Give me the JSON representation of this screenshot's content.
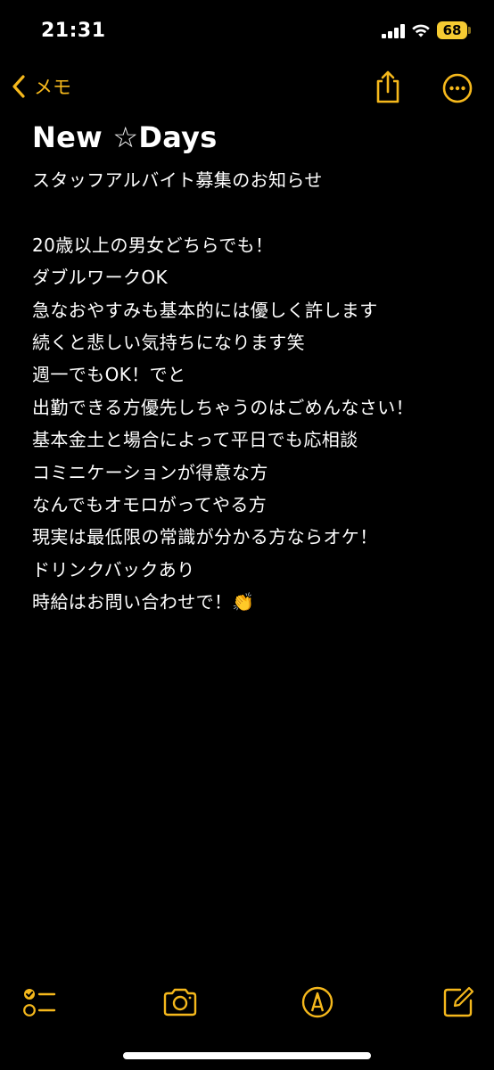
{
  "status_bar": {
    "time": "21:31",
    "battery": "68",
    "icons": [
      "cellular-signal-icon",
      "wifi-icon",
      "battery-icon"
    ]
  },
  "nav": {
    "back_label": "メモ",
    "back_icon": "chevron-left-icon",
    "share_icon": "share-icon",
    "more_icon": "ellipsis-circle-icon",
    "accent_color": "#f5b81c"
  },
  "note": {
    "title": "New ☆Days",
    "lines": [
      "スタッフアルバイト募集のお知らせ",
      "",
      "20歳以上の男女どちらでも！",
      "ダブルワークOK",
      "急なおやすみも基本的には優しく許します",
      "続くと悲しい気持ちになります笑",
      "週一でもOK！でと",
      "出勤できる方優先しちゃうのはごめんなさい！",
      "基本金土と場合によって平日でも応相談",
      "コミニケーションが得意な方",
      "なんでもオモロがってやる方",
      "現実は最低限の常識が分かる方ならオケ！",
      "ドリンクバックあり",
      "時給はお問い合わせで！👏"
    ]
  },
  "toolbar": {
    "icons": [
      "checklist-icon",
      "camera-icon",
      "markup-pen-icon",
      "compose-icon"
    ]
  },
  "colors": {
    "background": "#000000",
    "text": "#ffffff",
    "accent": "#f5b81c"
  }
}
